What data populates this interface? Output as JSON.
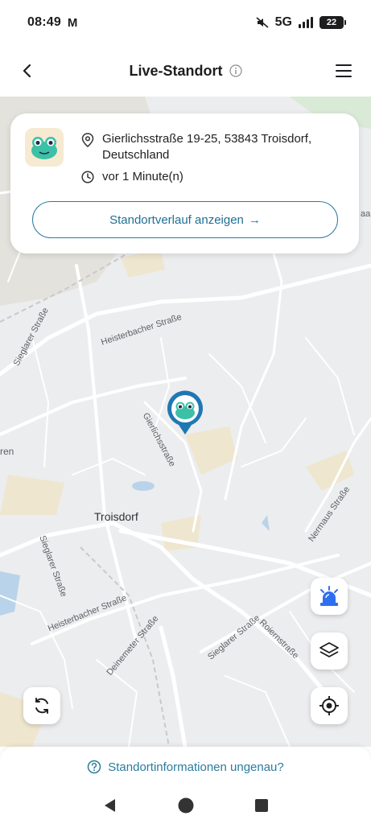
{
  "status_bar": {
    "time": "08:49",
    "mail_icon": "M",
    "network": "5G",
    "battery": "22"
  },
  "header": {
    "title": "Live-Standort"
  },
  "card": {
    "address": "Gierlichsstraße 19-25, 53843 Troisdorf, Deutschland",
    "time_ago": "vor 1 Minute(n)",
    "history_button": "Standortverlauf anzeigen",
    "history_arrow": "→"
  },
  "map": {
    "labels": {
      "sieglarer_1": "Sieglarer Straße",
      "heisterbacher_1": "Heisterbacher Straße",
      "gierlichs": "Gierlichsstraße",
      "ren": "ren",
      "troisdorf": "Troisdorf",
      "sieglarer_2": "Sieglarer Straße",
      "nermaus": "Nermaus Straße",
      "heisterbacher_2": "Heisterbacher Straße",
      "deinemeter": "Deinemeter Straße",
      "sieglarer_3": "Sieglarer Straße",
      "roiern": "Roiernstraße",
      "edge_right": "aa"
    }
  },
  "footer": {
    "inaccurate_link": "Standortinformationen ungenau?"
  },
  "colors": {
    "accent": "#2b7b9e",
    "pin": "#1f78b4",
    "map_bg": "#ecedee",
    "road": "#ffffff",
    "water": "#b9d3ea",
    "field": "#efe6cf",
    "alarm": "#2d6ff0"
  }
}
